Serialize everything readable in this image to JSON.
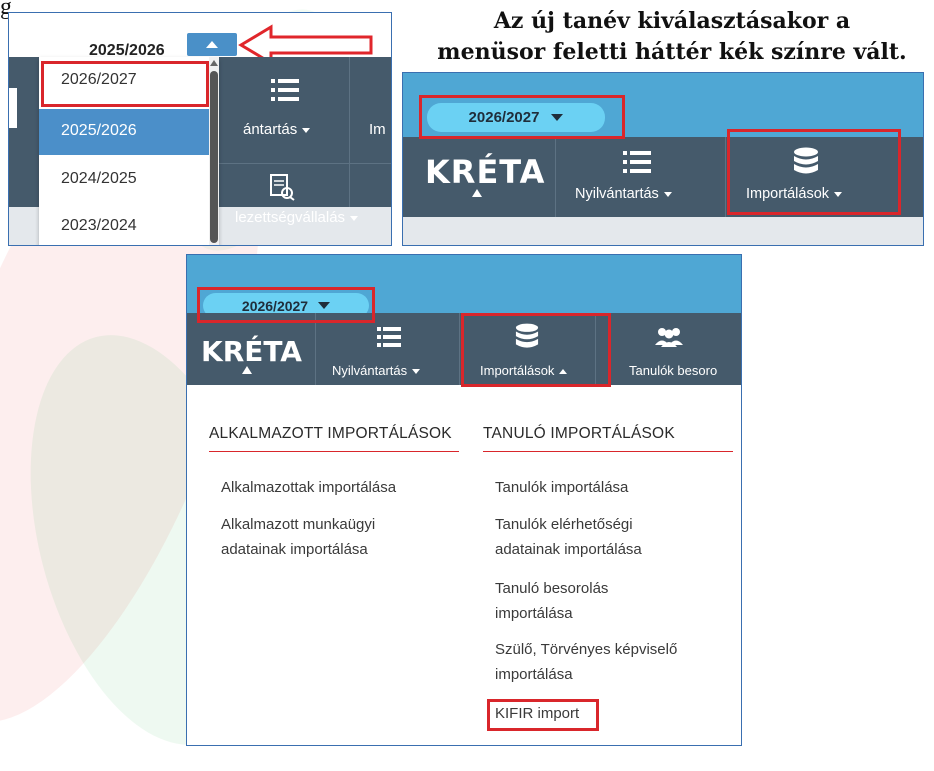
{
  "caption": {
    "line1": "Az új tanév kiválasztásakor a",
    "line2": "menüsor feletti háttér kék színre vált."
  },
  "corner_fragment": "g",
  "panel1": {
    "current_year": "2025/2026",
    "options": [
      "2026/2027",
      "2025/2026",
      "2024/2025",
      "2023/2024"
    ],
    "selected_option": "2026/2027",
    "highlighted_option": "2025/2026",
    "nav_partial_1": "ántartás",
    "nav_partial_2": "Im",
    "nav_partial_3": "lezettségvállalás"
  },
  "panel2": {
    "year_pill": "2026/2027",
    "logo": "KRÉTA",
    "nav_items": [
      "Nyilvántartás",
      "Importálások"
    ]
  },
  "panel3": {
    "year_pill": "2026/2027",
    "logo": "KRÉTA",
    "nav_items": [
      "Nyilvántartás",
      "Importálások",
      "Tanulók besoro"
    ],
    "menu": {
      "columns": [
        {
          "heading": "ALKALMAZOTT IMPORTÁLÁSOK",
          "links": [
            "Alkalmazottak importálása",
            "Alkalmazott munkaügyi adatainak importálása"
          ]
        },
        {
          "heading": "TANULÓ IMPORTÁLÁSOK",
          "links": [
            "Tanulók importálása",
            "Tanulók elérhetőségi adatainak importálása",
            "Tanuló besorolás importálása",
            "Szülő, Törvényes képviselő importálása",
            "KIFIR import"
          ]
        }
      ],
      "link_lines": {
        "alk2a": "Alkalmazott munkaügyi",
        "alk2b": "adatainak importálása",
        "tan2a": "Tanulók elérhetőségi",
        "tan2b": "adatainak importálása",
        "tan3a": "Tanuló besorolás",
        "tan3b": "importálása",
        "tan4a": "Szülő, Törvényes képviselő",
        "tan4b": "importálása"
      }
    }
  },
  "colors": {
    "highlight_red": "#d9262b",
    "nav_dark": "#455a6b",
    "top_blue": "#4fa7d4",
    "pill_blue": "#6bd1f3",
    "dropdown_selected": "#4b8fc9"
  }
}
